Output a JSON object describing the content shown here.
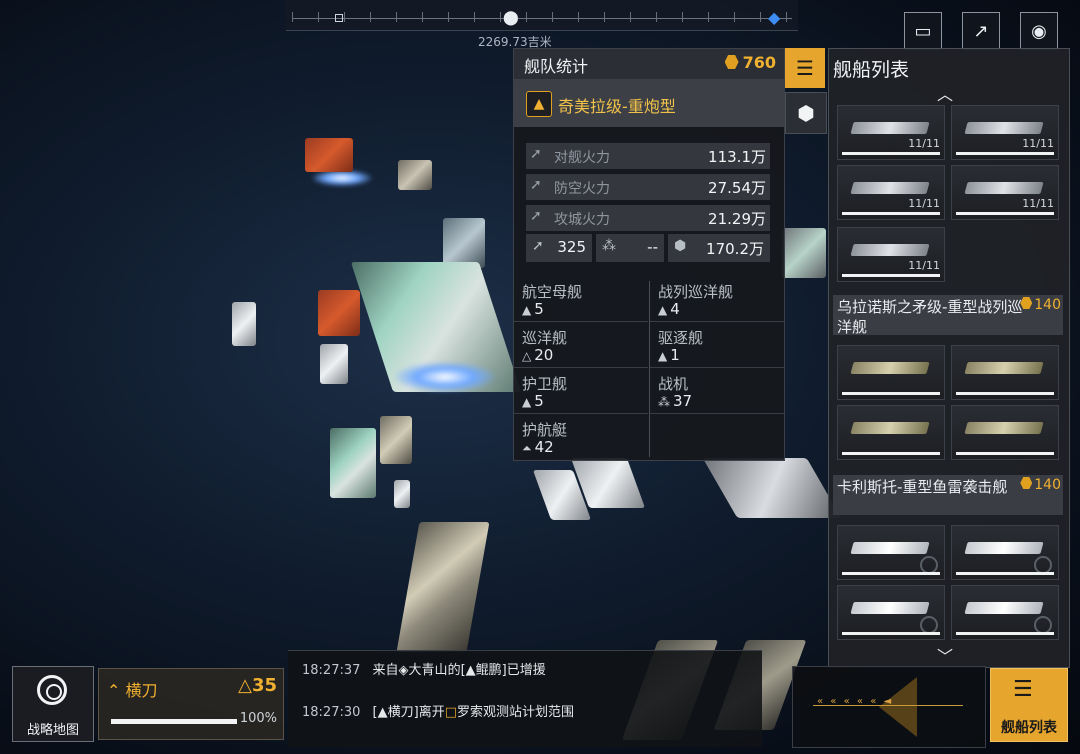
{
  "top_bar": {
    "distance": "2269.73吉米"
  },
  "fleet_stats": {
    "title": "舰队统计",
    "cost": "760",
    "ship_name": "奇美拉级-重炮型",
    "stats": [
      {
        "label": "对舰火力",
        "value": "113.1万",
        "icon": "anti-ship-icon"
      },
      {
        "label": "防空火力",
        "value": "27.54万",
        "icon": "anti-air-icon"
      },
      {
        "label": "攻城火力",
        "value": "21.29万",
        "icon": "siege-icon"
      }
    ],
    "mini_stats": {
      "speed": "325",
      "fighter": "--",
      "hp": "170.2万"
    },
    "classes": [
      {
        "name": "航空母舰",
        "count": "5"
      },
      {
        "name": "战列巡洋舰",
        "count": "4"
      },
      {
        "name": "巡洋舰",
        "count": "20"
      },
      {
        "name": "驱逐舰",
        "count": "1"
      },
      {
        "name": "护卫舰",
        "count": "5"
      },
      {
        "name": "战机",
        "count": "37"
      },
      {
        "name": "护航艇",
        "count": "42"
      }
    ]
  },
  "ship_list": {
    "title": "舰船列表",
    "group1": {
      "count_label": "11/11"
    },
    "group2": {
      "name": "乌拉诺斯之矛级-重型战列巡洋舰",
      "cost": "140"
    },
    "group3": {
      "name": "卡利斯托-重型鱼雷袭击舰",
      "cost": "140"
    }
  },
  "bottom": {
    "strategy_map": "战略地图",
    "fleet_name": "横刀",
    "fleet_level": "35",
    "fleet_hp": "100%",
    "ship_list_button": "舰船列表"
  },
  "messages": [
    {
      "time": "18:27:37",
      "pre": "来自",
      "a": "大青山",
      "mid1": "的[",
      "b": "鲲鹏",
      "post": "]已增援"
    },
    {
      "time": "18:27:30",
      "pre": "[",
      "a": "横刀",
      "mid1": "]离开",
      "b": "罗索观测站计划范围",
      "post": ""
    }
  ],
  "colors": {
    "accent": "#e6a52d",
    "gold_text": "#f0b030",
    "panel": "#16181c"
  }
}
